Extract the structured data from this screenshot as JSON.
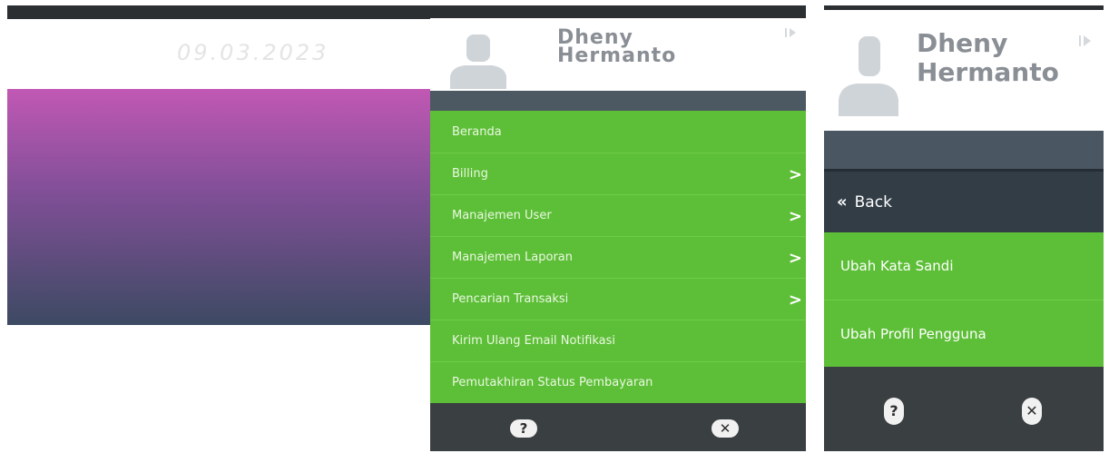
{
  "background_page": {
    "date": "09.03.2023",
    "gradient_colors": [
      "#c158b4",
      "#7f4f96",
      "#3d4a63"
    ]
  },
  "menu_main": {
    "user_name_line1": "Dheny",
    "user_name_line2": "Hermanto",
    "items": [
      {
        "label": "Beranda",
        "has_submenu": false
      },
      {
        "label": "Billing",
        "has_submenu": true
      },
      {
        "label": "Manajemen User",
        "has_submenu": true
      },
      {
        "label": "Manajemen Laporan",
        "has_submenu": true
      },
      {
        "label": "Pencarian Transaksi",
        "has_submenu": true
      },
      {
        "label": "Kirim Ulang Email Notifikasi",
        "has_submenu": false
      },
      {
        "label": "Pemutakhiran Status Pembayaran",
        "has_submenu": false
      }
    ],
    "submenu_arrow": ">",
    "footer": {
      "help_icon": "?",
      "close_icon": "✕"
    },
    "colors": {
      "menu_green": "#5dbf37",
      "footer_dark": "#3a3f42"
    }
  },
  "menu_sub": {
    "user_name_line1": "Dheny",
    "user_name_line2": "Hermanto",
    "back_chevron": "«",
    "back_label": "Back",
    "items": [
      {
        "label": "Ubah Kata Sandi"
      },
      {
        "label": "Ubah Profil Pengguna"
      }
    ],
    "footer": {
      "help_icon": "?",
      "close_icon": "✕"
    }
  }
}
